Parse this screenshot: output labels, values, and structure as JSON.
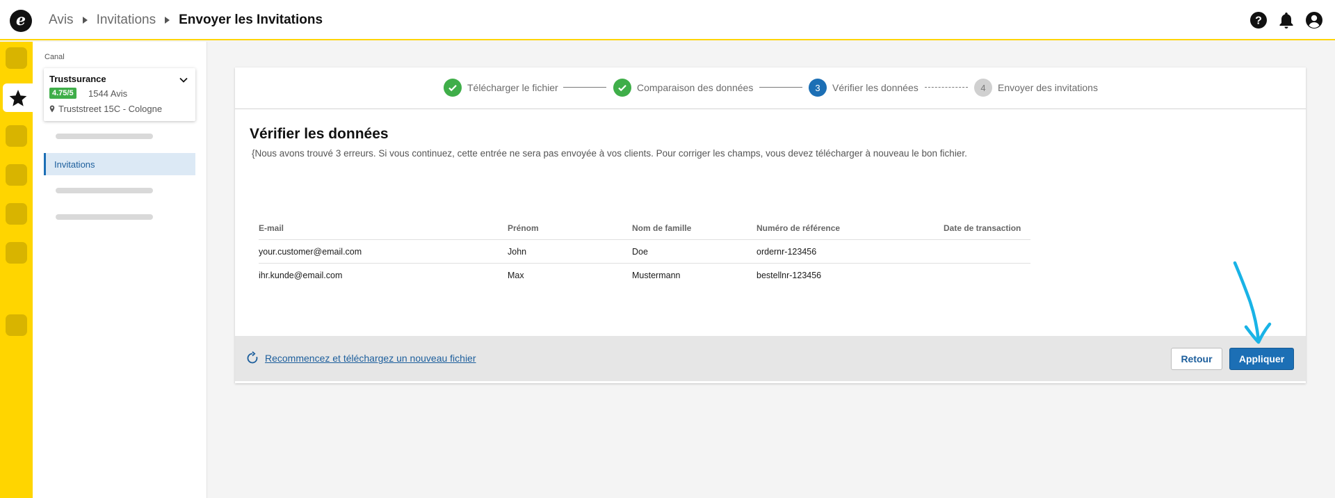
{
  "app": {
    "logo_letter": "e"
  },
  "breadcrumb": [
    "Avis",
    "Invitations",
    "Envoyer les Invitations"
  ],
  "header_icons": [
    "help-icon",
    "bell-icon",
    "user-icon"
  ],
  "sidebar": {
    "canal_label": "Canal",
    "company": {
      "name": "Trustsurance",
      "rating": "4.75/5",
      "reviews": "1544 Avis",
      "address": "Truststreet 15C - Cologne"
    },
    "active_item": "Invitations"
  },
  "stepper": [
    {
      "number": "1",
      "label": "Télécharger le fichier",
      "status": "done"
    },
    {
      "number": "2",
      "label": "Comparaison des données",
      "status": "done"
    },
    {
      "number": "3",
      "label": "Vérifier les données",
      "status": "current"
    },
    {
      "number": "4",
      "label": "Envoyer des invitations",
      "status": "pending"
    }
  ],
  "main": {
    "title": "Vérifier les données",
    "description": "{Nous avons trouvé 3 erreurs. Si vous continuez, cette entrée ne sera pas envoyée à vos clients. Pour corriger les champs, vous devez télécharger à nouveau le bon fichier."
  },
  "table": {
    "columns": [
      "E-mail",
      "Prénom",
      "Nom de famille",
      "Numéro de référence",
      "Date de transaction"
    ],
    "rows": [
      [
        "your.customer@email.com",
        "John",
        "Doe",
        "ordernr-123456",
        ""
      ],
      [
        "ihr.kunde@email.com",
        "Max",
        "Mustermann",
        "bestellnr-123456",
        ""
      ]
    ]
  },
  "footer": {
    "restart_label": "Recommencez et téléchargez un nouveau fichier",
    "back_label": "Retour",
    "apply_label": "Appliquer"
  },
  "colors": {
    "brand_yellow": "#ffd500",
    "primary_blue": "#1c6fb5",
    "success_green": "#3fae49",
    "annotation_cyan": "#19b3e6"
  }
}
